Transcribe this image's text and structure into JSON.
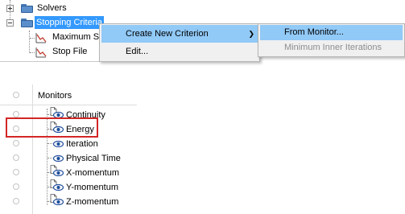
{
  "tree": {
    "solvers_label": "Solvers",
    "stopping_criteria_label": "Stopping Criteria",
    "children": [
      {
        "label": "Maximum St"
      },
      {
        "label": "Stop File"
      }
    ]
  },
  "context_menu": {
    "items": [
      {
        "label": "Create New Criterion",
        "has_submenu": true
      },
      {
        "label": "Edit..."
      }
    ]
  },
  "submenu": {
    "items": [
      {
        "label": "From Monitor..."
      },
      {
        "label": "Minimum Inner Iterations",
        "disabled": true
      }
    ]
  },
  "monitors": {
    "header": "Monitors",
    "items": [
      {
        "label": "Continuity",
        "icon": "plot-eye-icon"
      },
      {
        "label": "Energy",
        "icon": "plot-eye-icon"
      },
      {
        "label": "Iteration",
        "icon": "eye-icon"
      },
      {
        "label": "Physical Time",
        "icon": "eye-icon"
      },
      {
        "label": "X-momentum",
        "icon": "plot-eye-icon"
      },
      {
        "label": "Y-momentum",
        "icon": "plot-eye-icon"
      },
      {
        "label": "Z-momentum",
        "icon": "plot-eye-icon"
      }
    ]
  },
  "colors": {
    "selection": "#3399ff",
    "menu_highlight": "#91c9f7",
    "annotation_box": "#d32626",
    "folder": "#5b8fcc",
    "eye": "#1f4e9c"
  }
}
